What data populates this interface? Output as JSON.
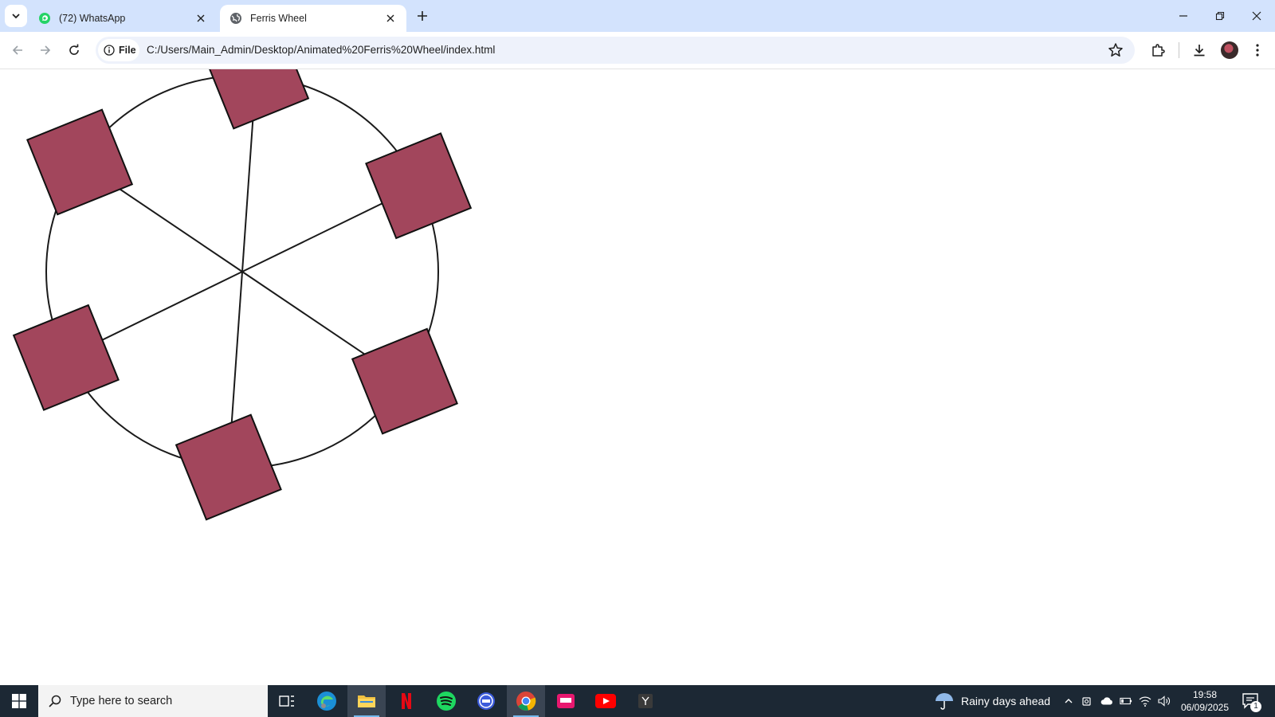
{
  "browser": {
    "tabs": [
      {
        "title": "(72) WhatsApp",
        "favicon": "whatsapp-icon",
        "active": false
      },
      {
        "title": "Ferris Wheel",
        "favicon": "globe-icon",
        "active": true
      }
    ],
    "address_bar": {
      "chip_label": "File",
      "url": "C:/Users/Main_Admin/Desktop/Animated%20Ferris%20Wheel/index.html"
    }
  },
  "scene": {
    "wheel_color": "#1a1a1a",
    "cabin_color": "#a2465c",
    "cabin_border": "#111111",
    "spoke_count": 6,
    "cabin_count": 6
  },
  "taskbar": {
    "search_placeholder": "Type here to search",
    "apps": [
      "task-view",
      "edge",
      "file-explorer",
      "netflix",
      "spotify",
      "isp",
      "chrome",
      "iptv",
      "youtube",
      "y-app"
    ],
    "weather": "Rainy days ahead",
    "time": "19:58",
    "date": "06/09/2025",
    "notification_count": "1"
  }
}
